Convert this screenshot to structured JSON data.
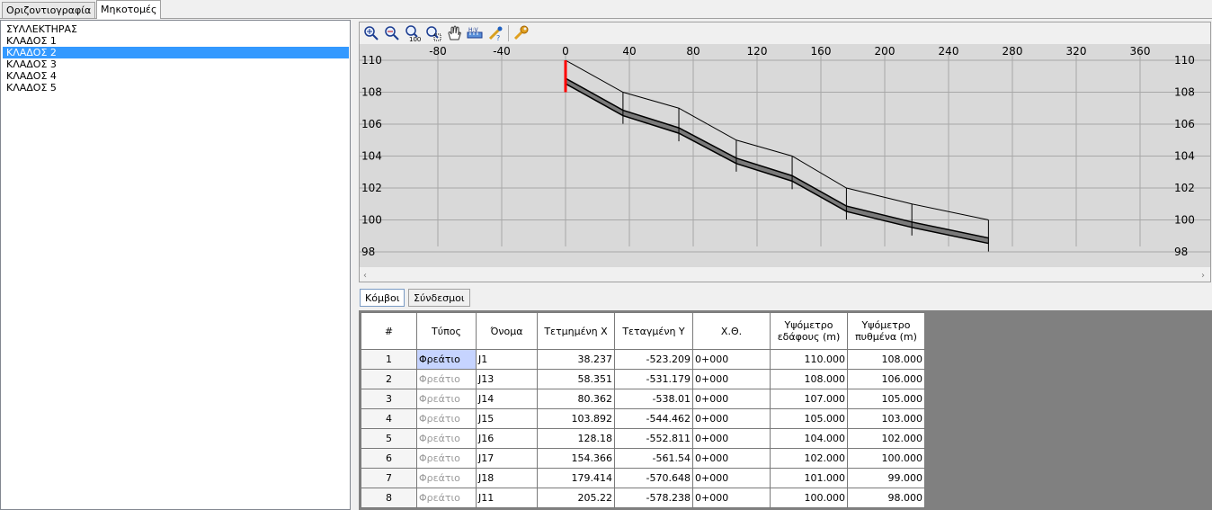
{
  "tabs": [
    "Οριζοντιογραφία",
    "Μηκοτομές"
  ],
  "tree": [
    "ΣΥΛΛΕΚΤΗΡΑΣ",
    "ΚΛΑΔΟΣ 1",
    "ΚΛΑΔΟΣ 2",
    "ΚΛΑΔΟΣ 3",
    "ΚΛΑΔΟΣ 4",
    "ΚΛΑΔΟΣ 5"
  ],
  "tree_selected": "ΚΛΑΔΟΣ 2",
  "toolbar": [
    "zoom-in-icon",
    "zoom-out-icon",
    "zoom-100-icon",
    "zoom-window-icon",
    "pan-hand-icon",
    "measure-icon",
    "edit-icon",
    "settings-wrench-icon"
  ],
  "chart_data": {
    "type": "line",
    "title": "",
    "xlim": [
      -110,
      390
    ],
    "ylim": [
      98,
      110
    ],
    "x_ticks": [
      -80,
      -40,
      0,
      40,
      80,
      120,
      160,
      200,
      240,
      280,
      320,
      360
    ],
    "y_ticks": [
      98,
      100,
      102,
      104,
      106,
      108,
      110
    ],
    "nodes_x": [
      0,
      36,
      71,
      107,
      142,
      176,
      217,
      265
    ],
    "series": [
      {
        "values": [
          110,
          108,
          107,
          105,
          104,
          102,
          101,
          100
        ]
      },
      {
        "values": [
          108.7,
          106.7,
          105.6,
          103.7,
          102.6,
          100.7,
          99.7,
          98.7
        ]
      }
    ],
    "colors": {
      "ground": "#000000",
      "pipe": "#404040",
      "marker": "#ff0000",
      "bg": "#d9d9d9",
      "grid": "#a8a8a8"
    }
  },
  "subtabs": [
    "Κόμβοι",
    "Σύνδεσμοι"
  ],
  "table": {
    "headers": [
      "#",
      "Τύπος",
      "Όνομα",
      "Τετμημένη X",
      "Τεταγμένη Y",
      "Χ.Θ.",
      "Υψόμετρο εδάφους (m)",
      "Υψόμετρο πυθμένα (m)"
    ],
    "rows": [
      [
        "1",
        "Φρεάτιο",
        "J1",
        "38.237",
        "-523.209",
        "0+000",
        "110.000",
        "108.000"
      ],
      [
        "2",
        "Φρεάτιο",
        "J13",
        "58.351",
        "-531.179",
        "0+000",
        "108.000",
        "106.000"
      ],
      [
        "3",
        "Φρεάτιο",
        "J14",
        "80.362",
        "-538.01",
        "0+000",
        "107.000",
        "105.000"
      ],
      [
        "4",
        "Φρεάτιο",
        "J15",
        "103.892",
        "-544.462",
        "0+000",
        "105.000",
        "103.000"
      ],
      [
        "5",
        "Φρεάτιο",
        "J16",
        "128.18",
        "-552.811",
        "0+000",
        "104.000",
        "102.000"
      ],
      [
        "6",
        "Φρεάτιο",
        "J17",
        "154.366",
        "-561.54",
        "0+000",
        "102.000",
        "100.000"
      ],
      [
        "7",
        "Φρεάτιο",
        "J18",
        "179.414",
        "-570.648",
        "0+000",
        "101.000",
        "99.000"
      ],
      [
        "8",
        "Φρεάτιο",
        "J11",
        "205.22",
        "-578.238",
        "0+000",
        "100.000",
        "98.000"
      ]
    ]
  }
}
